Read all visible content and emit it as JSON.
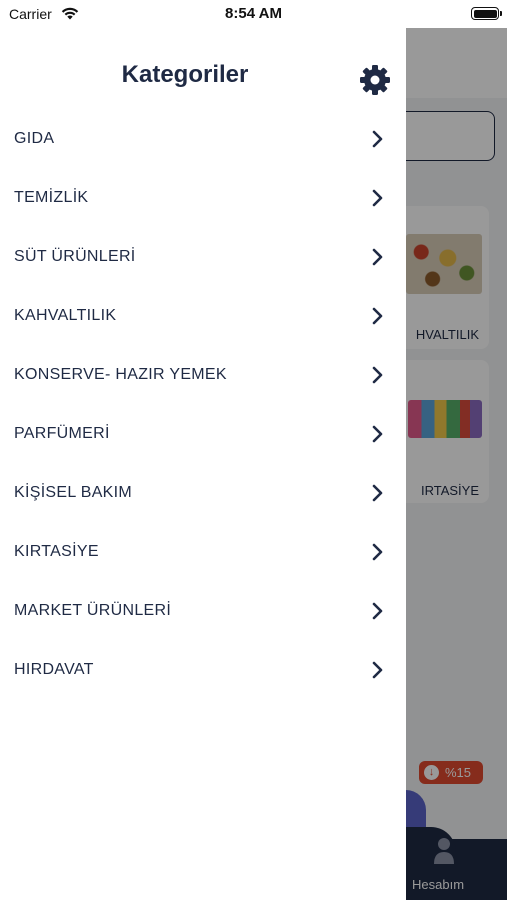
{
  "status_bar": {
    "carrier": "Carrier",
    "time": "8:54 AM"
  },
  "drawer": {
    "title": "Kategoriler",
    "categories": [
      {
        "label": "GIDA"
      },
      {
        "label": "TEMİZLİK"
      },
      {
        "label": "SÜT ÜRÜNLERİ"
      },
      {
        "label": "KAHVALTILIK"
      },
      {
        "label": "KONSERVE- HAZIR YEMEK"
      },
      {
        "label": "PARFÜMERİ"
      },
      {
        "label": "KİŞİSEL BAKIM"
      },
      {
        "label": "KIRTASİYE"
      },
      {
        "label": "MARKET ÜRÜNLERİ"
      },
      {
        "label": "HIRDAVAT"
      }
    ]
  },
  "background": {
    "cards": [
      {
        "label": "HVALTILIK"
      },
      {
        "label": "IRTASİYE"
      }
    ],
    "discount_badge": "%15",
    "tab_label": "Hesabım"
  },
  "colors": {
    "primary": "#1f2a44",
    "accent": "#e04a2f",
    "overlay": "rgba(0,0,0,0.4)"
  },
  "icons": [
    "wifi-icon",
    "battery-icon",
    "gear-icon",
    "chevron-right-icon",
    "person-icon",
    "arrow-down-circle-icon"
  ]
}
